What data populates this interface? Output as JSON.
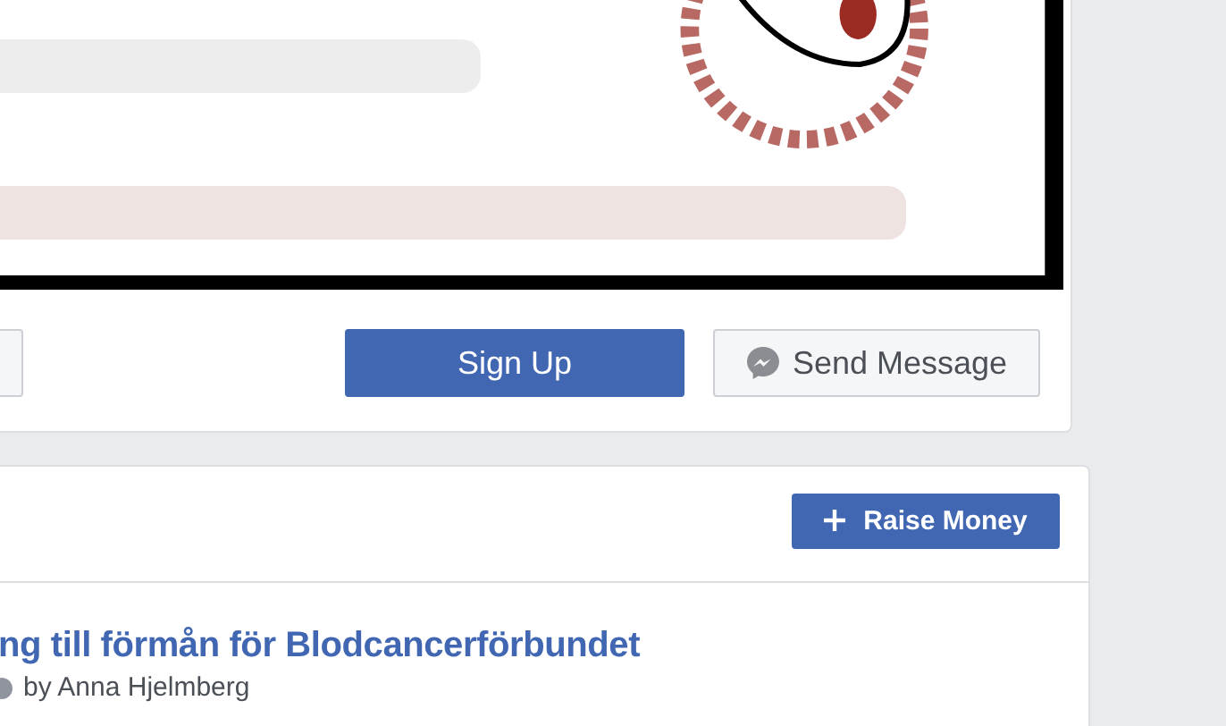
{
  "actions": [
    {
      "label": "Sign Up",
      "kind": "primary"
    },
    {
      "label": "Send Message",
      "kind": "message"
    }
  ],
  "fundraiser": {
    "button": "Raise Money",
    "title": "ng till förmån för Blodcancerförbundet",
    "byline": "by Anna Hjelmberg"
  }
}
